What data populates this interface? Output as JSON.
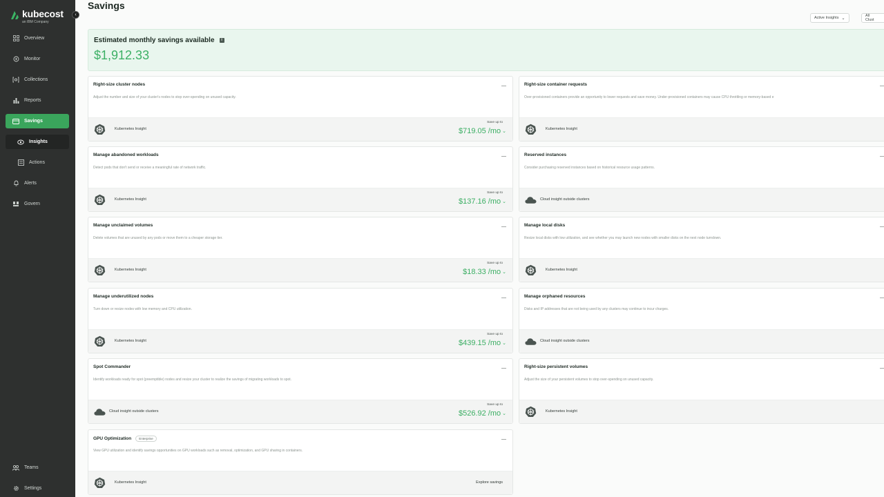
{
  "app": {
    "logo_name": "kubecost",
    "logo_sub": "an IBM Company"
  },
  "sidebar": {
    "items": [
      {
        "label": "Overview",
        "icon": "grid-icon"
      },
      {
        "label": "Monitor",
        "icon": "monitor-icon"
      },
      {
        "label": "Collections",
        "icon": "collections-icon"
      },
      {
        "label": "Reports",
        "icon": "bar-chart-icon"
      },
      {
        "label": "Savings",
        "icon": "savings-icon",
        "active": true
      },
      {
        "label": "Insights",
        "icon": "insights-icon",
        "sub": true,
        "selected": true
      },
      {
        "label": "Actions",
        "icon": "actions-icon",
        "sub": true
      },
      {
        "label": "Alerts",
        "icon": "bell-icon"
      },
      {
        "label": "Govern",
        "icon": "govern-icon"
      }
    ],
    "bottom_items": [
      {
        "label": "Teams",
        "icon": "teams-icon"
      },
      {
        "label": "Settings",
        "icon": "gear-icon"
      }
    ]
  },
  "header": {
    "title": "Savings",
    "filter_insights": "Active Insights",
    "filter_clusters": "All Clust"
  },
  "summary": {
    "title": "Estimated monthly savings available",
    "value": "$1,912.33"
  },
  "labels": {
    "save_up_to": "Save up to",
    "kubernetes_insight": "Kubernetes Insight",
    "cloud_insight": "Cloud insight outside clusters",
    "explore": "Explore savings",
    "enterprise": "Enterprise"
  },
  "cards_left": [
    {
      "title": "Right-size cluster nodes",
      "desc": "Adjust the number and size of your cluster's nodes to stop over-spending on unused capacity.",
      "source": "kubernetes",
      "savings": "$719.05 /mo"
    },
    {
      "title": "Manage abandoned workloads",
      "desc": "Detect pods that don't send or receive a meaningful rate of network traffic.",
      "source": "kubernetes",
      "savings": "$137.16 /mo"
    },
    {
      "title": "Manage unclaimed volumes",
      "desc": "Delete volumes that are unused by any pods or move them to a cheaper storage tier.",
      "source": "kubernetes",
      "savings": "$18.33 /mo"
    },
    {
      "title": "Manage underutilized nodes",
      "desc": "Turn down or resize nodes with low memory and CPU utilization.",
      "source": "kubernetes",
      "savings": "$439.15 /mo"
    },
    {
      "title": "Spot Commander",
      "desc": "Identify workloads ready for spot (preemptible) nodes and resize your cluster to realize the savings of migrating workloads to spot.",
      "source": "cloud",
      "savings": "$526.92 /mo"
    },
    {
      "title": "GPU Optimization",
      "desc": "View GPU utilization and identify savings opportunities on GPU workloads such as removal, optimization, and GPU sharing in containers.",
      "source": "kubernetes",
      "savings": null,
      "badge": true
    }
  ],
  "cards_right": [
    {
      "title": "Right-size container requests",
      "desc": "Over-provisioned containers provide an opportunity to lower requests and save money. Under-provisioned containers may cause CPU throttling or memory-based e",
      "source": "kubernetes"
    },
    {
      "title": "Reserved instances",
      "desc": "Consider purchasing reserved instances based on historical resource usage patterns.",
      "source": "cloud"
    },
    {
      "title": "Manage local disks",
      "desc": "Resize local disks with low utilization, and see whether you may launch new nodes with smaller disks on the next node turndown.",
      "source": "kubernetes"
    },
    {
      "title": "Manage orphaned resources",
      "desc": "Disks and IP addresses that are not being used by any clusters may continue to incur charges.",
      "source": "cloud"
    },
    {
      "title": "Right-size persistent volumes",
      "desc": "Adjust the size of your persistent volumes to stop over-spending on unused capacity.",
      "source": "kubernetes"
    }
  ]
}
